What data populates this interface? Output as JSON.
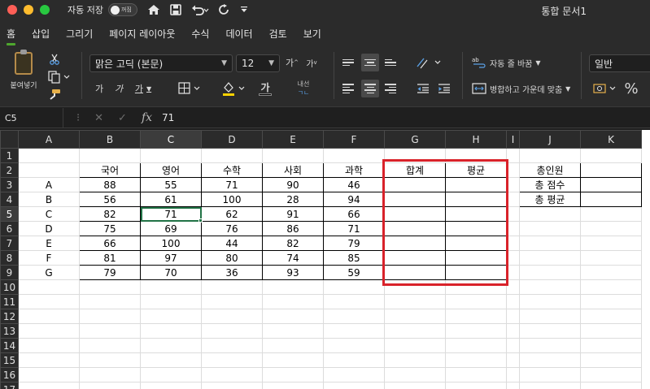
{
  "titlebar": {
    "autosave_label": "자동 저장",
    "autosave_state": "꺼짐",
    "doc_title": "통합 문서1"
  },
  "menu": {
    "tabs": [
      "홈",
      "삽입",
      "그리기",
      "페이지 레이아웃",
      "수식",
      "데이터",
      "검토",
      "보기"
    ],
    "active": "홈"
  },
  "ribbon": {
    "paste_label": "붙여넣기",
    "font_name": "맑은 고딕 (본문)",
    "font_size": "12",
    "grow_font": "가",
    "shrink_font": "가",
    "bold": "가",
    "italic": "가",
    "underline": "가",
    "font_color_glyph": "가",
    "phonetic_label": "내선",
    "wrap_text": "자동 줄 바꿈",
    "merge_center": "병합하고 가운데 맞춤",
    "number_format": "일반",
    "percent": "%"
  },
  "formula_bar": {
    "name_box": "C5",
    "fx": "fx",
    "value": "71"
  },
  "sheet": {
    "columns": [
      "A",
      "B",
      "C",
      "D",
      "E",
      "F",
      "G",
      "H",
      "I",
      "J",
      "K"
    ],
    "rows": [
      "1",
      "2",
      "3",
      "4",
      "5",
      "6",
      "7",
      "8",
      "9",
      "10",
      "11",
      "12",
      "13",
      "14",
      "15",
      "16",
      "17"
    ],
    "selected_col": "C",
    "selected_row": "5",
    "headers": [
      "국어",
      "영어",
      "수학",
      "사회",
      "과학",
      "합계",
      "평균"
    ],
    "students": [
      {
        "name": "A",
        "scores": [
          "88",
          "55",
          "71",
          "90",
          "46"
        ]
      },
      {
        "name": "B",
        "scores": [
          "56",
          "61",
          "100",
          "28",
          "94"
        ]
      },
      {
        "name": "C",
        "scores": [
          "82",
          "71",
          "62",
          "91",
          "66"
        ]
      },
      {
        "name": "D",
        "scores": [
          "75",
          "69",
          "76",
          "86",
          "71"
        ]
      },
      {
        "name": "E",
        "scores": [
          "66",
          "100",
          "44",
          "82",
          "79"
        ]
      },
      {
        "name": "F",
        "scores": [
          "81",
          "97",
          "80",
          "74",
          "85"
        ]
      },
      {
        "name": "G",
        "scores": [
          "79",
          "70",
          "36",
          "93",
          "59"
        ]
      }
    ],
    "summary_labels": [
      "총인원",
      "총 점수",
      "총 평균"
    ]
  },
  "colors": {
    "accent": "#4ea72e",
    "highlight_box": "#d9222a",
    "selection": "#217346"
  }
}
